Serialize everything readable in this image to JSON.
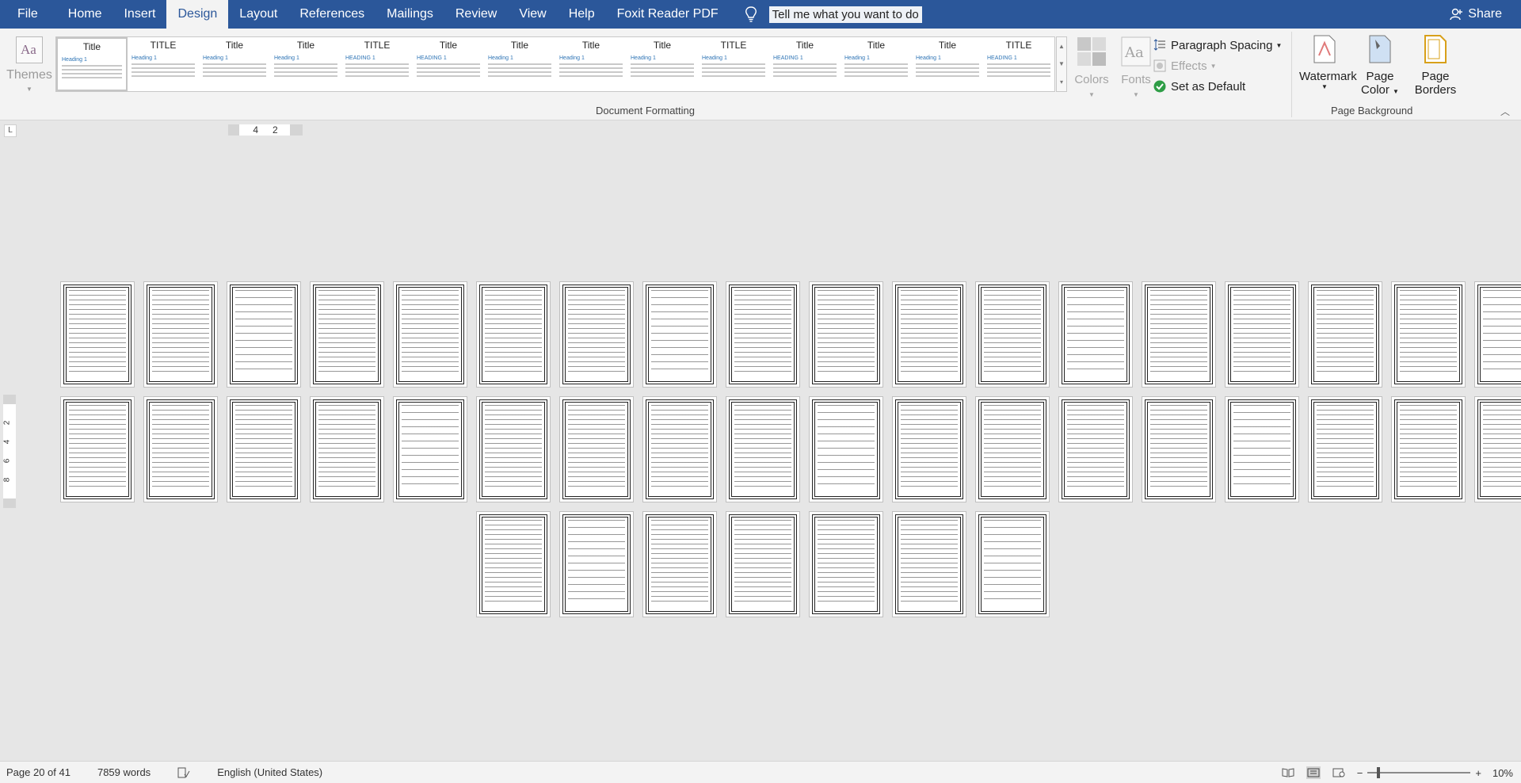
{
  "tabs": {
    "file": "File",
    "home": "Home",
    "insert": "Insert",
    "design": "Design",
    "layout": "Layout",
    "references": "References",
    "mailings": "Mailings",
    "review": "Review",
    "view": "View",
    "help": "Help",
    "foxit": "Foxit Reader PDF",
    "active": "Design"
  },
  "tell_me": "Tell me what you want to do",
  "share": "Share",
  "ribbon": {
    "themes_label": "Themes",
    "group_document_formatting": "Document Formatting",
    "group_page_background": "Page Background",
    "colors_label": "Colors",
    "fonts_label": "Fonts",
    "paragraph_spacing": "Paragraph Spacing",
    "effects": "Effects",
    "set_as_default": "Set as Default",
    "watermark": "Watermark",
    "page_color_line1": "Page",
    "page_color_line2": "Color",
    "page_borders_line1": "Page",
    "page_borders_line2": "Borders",
    "style_titles": [
      "Title",
      "TITLE",
      "Title",
      "Title",
      "TITLE",
      "Title",
      "Title",
      "Title",
      "Title",
      "TITLE",
      "Title",
      "Title",
      "Title",
      "TITLE"
    ],
    "style_headings": [
      "Heading 1",
      "Heading 1",
      "Heading 1",
      "Heading 1",
      "HEADING 1",
      "HEADING 1",
      "Heading 1",
      "Heading 1",
      "Heading 1",
      "Heading 1",
      "HEADING 1",
      "Heading 1",
      "Heading 1",
      "HEADING 1"
    ]
  },
  "ruler": {
    "tab_selector": "L",
    "h_left": "4",
    "h_right": "2",
    "v_labels": [
      "2",
      "4",
      "6",
      "8"
    ]
  },
  "document": {
    "page_count": 41,
    "rows": [
      18,
      18,
      7
    ]
  },
  "status": {
    "page": "Page 20 of 41",
    "words": "7859 words",
    "language": "English (United States)",
    "zoom": "10%"
  },
  "colors": {
    "accent": "#2b579a",
    "ribbon_bg": "#f3f3f3",
    "canvas_bg": "#e6e6e6"
  }
}
